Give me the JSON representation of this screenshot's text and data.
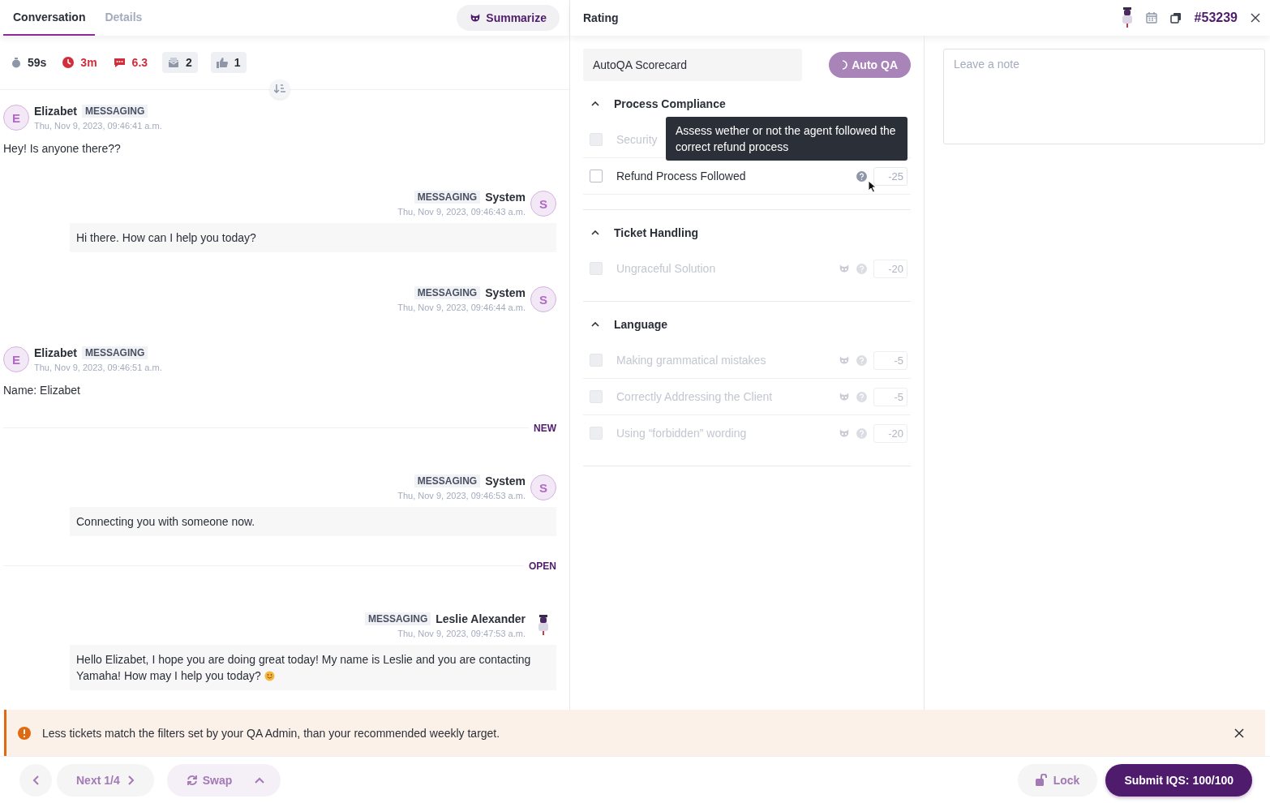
{
  "tabs": [
    {
      "label": "Conversation",
      "selected": true
    },
    {
      "label": "Details",
      "selected": false
    }
  ],
  "summarize_button": "Summarize",
  "stats": [
    {
      "kind": "timer",
      "value": "59s",
      "alert": false,
      "boxed": false
    },
    {
      "kind": "clock",
      "value": "3m",
      "alert": true,
      "boxed": false
    },
    {
      "kind": "chat",
      "value": "6.3",
      "alert": true,
      "boxed": false
    },
    {
      "kind": "inbox",
      "value": "2",
      "alert": false,
      "boxed": true
    },
    {
      "kind": "thumb",
      "value": "1",
      "alert": false,
      "boxed": true
    }
  ],
  "messages": [
    {
      "kind": "incoming",
      "author": "Elizabet",
      "avatar": {
        "kind": "letter",
        "text": "E"
      },
      "channel": "MESSAGING",
      "time": "Thu, Nov 9, 2023, 09:46:41 a.m.",
      "text": "Hey! Is anyone there??"
    },
    {
      "kind": "outgoing",
      "author": "System",
      "avatar": {
        "kind": "letter",
        "text": "S"
      },
      "channel": "MESSAGING",
      "time": "Thu, Nov 9, 2023, 09:46:43 a.m.",
      "text": "Hi there. How can I help you today?"
    },
    {
      "kind": "outgoing",
      "author": "System",
      "avatar": {
        "kind": "letter",
        "text": "S"
      },
      "channel": "MESSAGING",
      "time": "Thu, Nov 9, 2023, 09:46:44 a.m."
    },
    {
      "kind": "incoming",
      "author": "Elizabet",
      "avatar": {
        "kind": "letter",
        "text": "E"
      },
      "channel": "MESSAGING",
      "time": "Thu, Nov 9, 2023, 09:46:51 a.m.",
      "text": "Name: Elizabet"
    },
    {
      "kind": "divider",
      "label": "NEW"
    },
    {
      "kind": "outgoing",
      "author": "System",
      "avatar": {
        "kind": "letter",
        "text": "S"
      },
      "channel": "MESSAGING",
      "time": "Thu, Nov 9, 2023, 09:46:53 a.m.",
      "text": "Connecting you with someone now."
    },
    {
      "kind": "divider",
      "label": "OPEN"
    },
    {
      "kind": "outgoing",
      "author": "Leslie Alexander",
      "avatar": {
        "kind": "figure"
      },
      "channel": "MESSAGING",
      "time": "Thu, Nov 9, 2023, 09:47:53 a.m.",
      "text": "Hello Elizabet, I hope you are doing great today! My name is Leslie and you are contacting Yamaha! How may I help you today?",
      "smiley": true
    }
  ],
  "banner": {
    "text": "Less tickets match the filters set by your QA Admin, than your recommended weekly target."
  },
  "footer": {
    "next_button": "Next 1/4",
    "swap_button": "Swap",
    "lock_button": "Lock",
    "submit_button": "Submit IQS: 100/100"
  },
  "rating": {
    "title": "Rating",
    "ticket": "#53239",
    "scorecard": "AutoQA Scorecard",
    "autoqa_button": "Auto QA",
    "autoqa_busy": true,
    "sections": [
      {
        "title": "Process Compliance",
        "expanded": true,
        "items": [
          {
            "label": "Security",
            "checked": false,
            "disabled": true
          },
          {
            "label": "Refund Process Followed",
            "checked": false,
            "disabled": false,
            "autoqa": false,
            "help": true,
            "points": "-25"
          }
        ]
      },
      {
        "title": "Ticket Handling",
        "expanded": true,
        "items": [
          {
            "label": "Ungraceful Solution",
            "checked": false,
            "disabled": true,
            "autoqa": true,
            "help": true,
            "points": "-20"
          }
        ]
      },
      {
        "title": "Language",
        "expanded": true,
        "items": [
          {
            "label": "Making grammatical mistakes",
            "checked": false,
            "disabled": true,
            "autoqa": true,
            "help": true,
            "points": "-5"
          },
          {
            "label": "Correctly Addressing the Client",
            "checked": false,
            "disabled": true,
            "autoqa": true,
            "help": true,
            "points": "-5"
          },
          {
            "label": "Using “forbidden” wording",
            "checked": false,
            "disabled": true,
            "autoqa": true,
            "help": true,
            "points": "-20"
          }
        ]
      }
    ],
    "tooltip": {
      "text": "Assess wether or not the agent followed the correct refund process"
    },
    "note": {
      "placeholder": "Leave a note"
    }
  }
}
